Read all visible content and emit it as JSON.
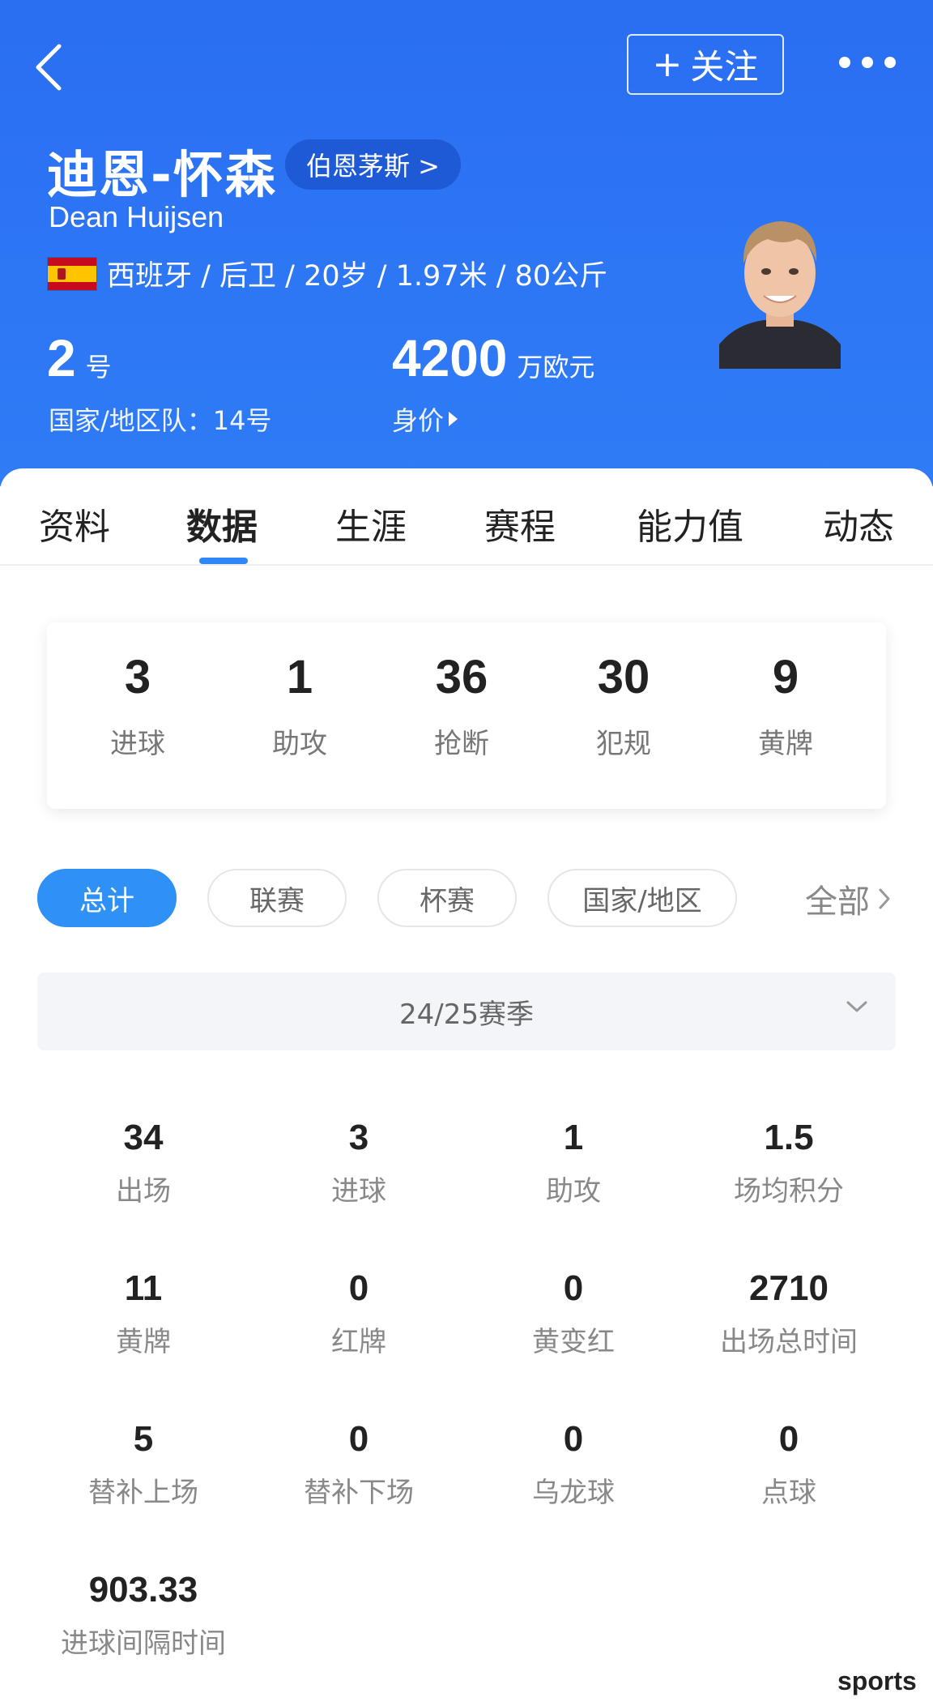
{
  "header": {
    "follow_label": "关注",
    "player_name_cn": "迪恩-怀森",
    "team_chip": "伯恩茅斯 >",
    "player_name_en": "Dean Huijsen",
    "info_line": "西班牙 / 后卫 / 20岁 / 1.97米 / 80公斤",
    "shirt_number": "2",
    "shirt_unit": "号",
    "national_team_number": "国家/地区队：14号",
    "market_value": "4200",
    "market_value_unit": "万欧元",
    "market_value_label": "身价"
  },
  "tabs": [
    "资料",
    "数据",
    "生涯",
    "赛程",
    "能力值",
    "动态"
  ],
  "active_tab": "数据",
  "summary": [
    {
      "value": "3",
      "label": "进球"
    },
    {
      "value": "1",
      "label": "助攻"
    },
    {
      "value": "36",
      "label": "抢断"
    },
    {
      "value": "30",
      "label": "犯规"
    },
    {
      "value": "9",
      "label": "黄牌"
    }
  ],
  "filters": [
    "总计",
    "联赛",
    "杯赛",
    "国家/地区"
  ],
  "filter_all": "全部",
  "season": "24/25赛季",
  "stats": [
    {
      "value": "34",
      "label": "出场"
    },
    {
      "value": "3",
      "label": "进球"
    },
    {
      "value": "1",
      "label": "助攻"
    },
    {
      "value": "1.5",
      "label": "场均积分"
    },
    {
      "value": "11",
      "label": "黄牌"
    },
    {
      "value": "0",
      "label": "红牌"
    },
    {
      "value": "0",
      "label": "黄变红"
    },
    {
      "value": "2710",
      "label": "出场总时间"
    },
    {
      "value": "5",
      "label": "替补上场"
    },
    {
      "value": "0",
      "label": "替补下场"
    },
    {
      "value": "0",
      "label": "乌龙球"
    },
    {
      "value": "0",
      "label": "点球"
    },
    {
      "value": "903.33",
      "label": "进球间隔时间"
    }
  ],
  "watermark": "sports",
  "colors": {
    "header_blue": "#2f7cf6",
    "accent": "#2f91f5"
  },
  "icons": [
    "back-arrow-icon",
    "plus-icon",
    "more-dots-icon",
    "spain-flag-icon",
    "triangle-right-icon",
    "chevron-right-icon",
    "chevron-down-icon"
  ]
}
